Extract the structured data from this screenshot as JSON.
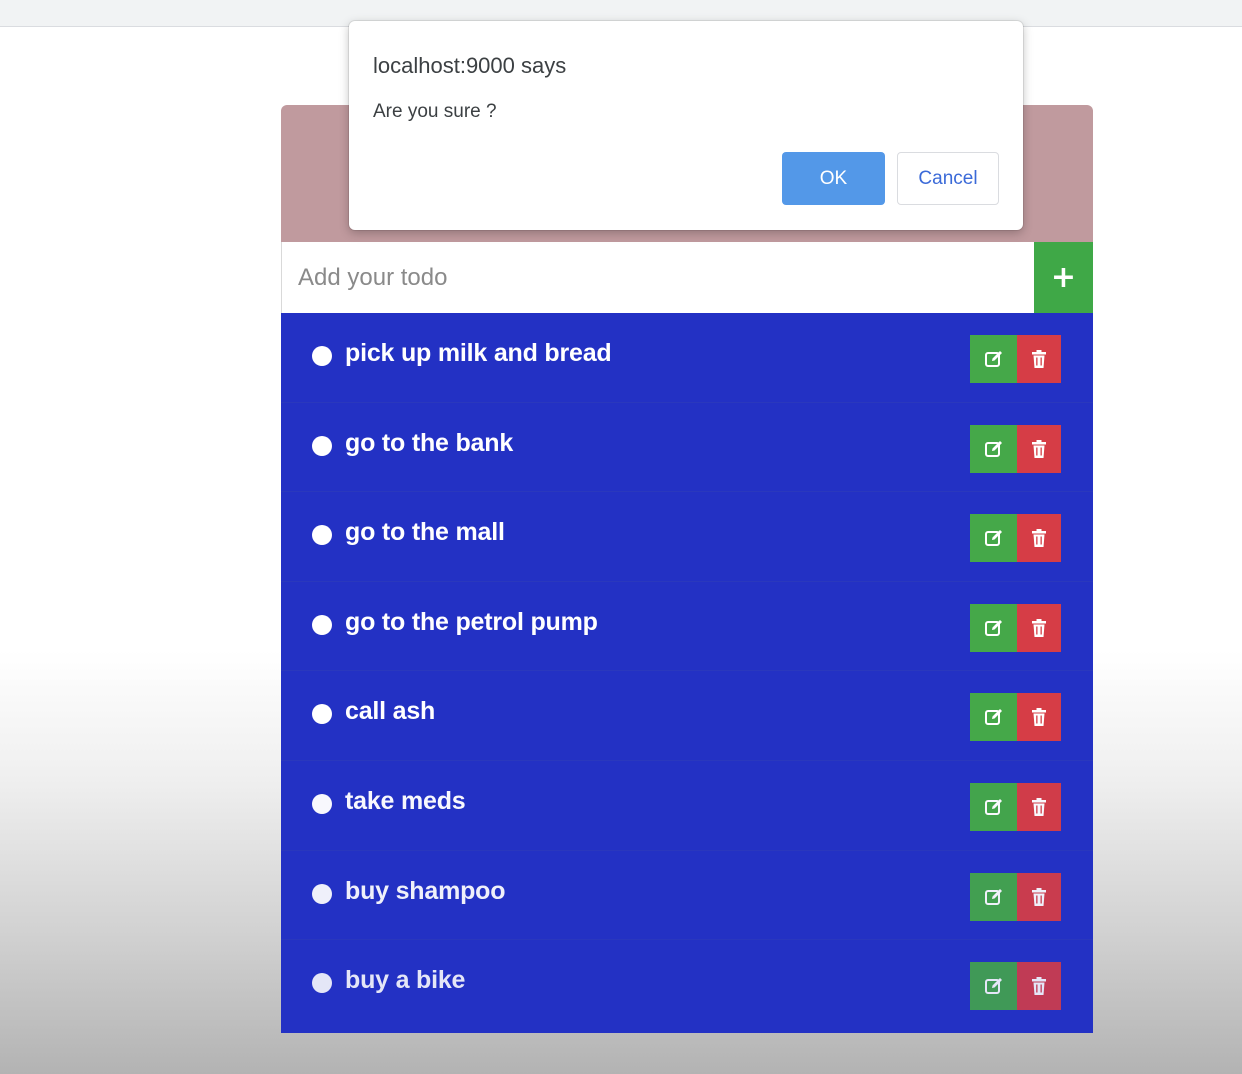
{
  "dialog": {
    "title": "localhost:9000 says",
    "message": "Are you sure ?",
    "ok_label": "OK",
    "cancel_label": "Cancel"
  },
  "input": {
    "placeholder": "Add your todo",
    "value": ""
  },
  "add_button": {
    "label": "+",
    "icon": "plus-icon"
  },
  "todos": [
    {
      "text": "pick up milk and bread"
    },
    {
      "text": "go to the bank"
    },
    {
      "text": "go to the mall"
    },
    {
      "text": "go to the petrol pump"
    },
    {
      "text": "call ash"
    },
    {
      "text": "take meds"
    },
    {
      "text": "buy shampoo"
    },
    {
      "text": "buy a bike"
    }
  ],
  "item_actions": {
    "edit_icon": "edit-icon",
    "delete_icon": "trash-icon"
  },
  "colors": {
    "header": "#c09a9e",
    "list_background": "#2331c4",
    "add_button": "#3fa847",
    "edit_button": "#45a849",
    "delete_button": "#d63d46",
    "dialog_ok": "#5398e8"
  }
}
